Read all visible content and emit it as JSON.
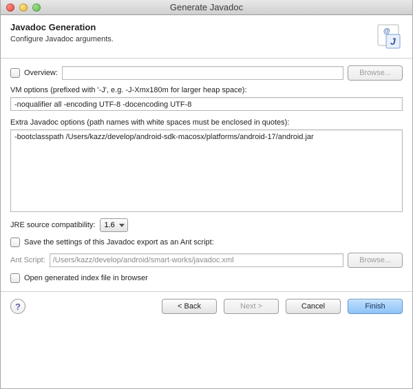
{
  "window": {
    "title": "Generate Javadoc"
  },
  "header": {
    "title": "Javadoc Generation",
    "subtitle": "Configure Javadoc arguments."
  },
  "overview": {
    "label": "Overview:",
    "value": "",
    "browse": "Browse..."
  },
  "vm": {
    "label": "VM options (prefixed with '-J', e.g. -J-Xmx180m for larger heap space):",
    "value": "-noqualifier all -encoding UTF-8 -docencoding UTF-8"
  },
  "extra": {
    "label": "Extra Javadoc options (path names with white spaces must be enclosed in quotes):",
    "value": "-bootclasspath /Users/kazz/develop/android-sdk-macosx/platforms/android-17/android.jar"
  },
  "jre": {
    "label": "JRE source compatibility:",
    "value": "1.6"
  },
  "saveAnt": {
    "label": "Save the settings of this Javadoc export as an Ant script:"
  },
  "antScript": {
    "label": "Ant Script:",
    "value": "/Users/kazz/develop/android/smart-works/javadoc.xml",
    "browse": "Browse..."
  },
  "openIndex": {
    "label": "Open generated index file in browser"
  },
  "buttons": {
    "back": "< Back",
    "next": "Next >",
    "cancel": "Cancel",
    "finish": "Finish"
  },
  "help": "?"
}
